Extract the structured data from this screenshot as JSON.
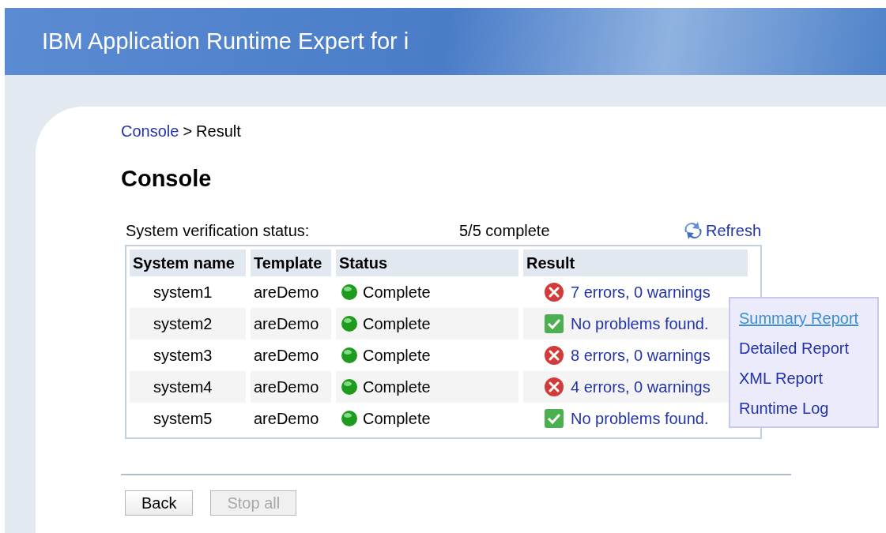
{
  "header": {
    "title": "IBM Application Runtime Expert for i"
  },
  "breadcrumb": {
    "link": "Console",
    "separator": ">",
    "current": "Result"
  },
  "heading": "Console",
  "status_line": {
    "label": "System verification status:",
    "value": "5/5 complete",
    "refresh": "Refresh"
  },
  "table": {
    "columns": [
      "System name",
      "Template",
      "Status",
      "Result"
    ],
    "rows": [
      {
        "system": "system1",
        "template": "areDemo",
        "status": "Complete",
        "result": "7 errors, 0 warnings",
        "kind": "error"
      },
      {
        "system": "system2",
        "template": "areDemo",
        "status": "Complete",
        "result": "No problems found.",
        "kind": "ok"
      },
      {
        "system": "system3",
        "template": "areDemo",
        "status": "Complete",
        "result": "8 errors, 0 warnings",
        "kind": "error"
      },
      {
        "system": "system4",
        "template": "areDemo",
        "status": "Complete",
        "result": "4 errors, 0 warnings",
        "kind": "error"
      },
      {
        "system": "system5",
        "template": "areDemo",
        "status": "Complete",
        "result": "No problems found.",
        "kind": "ok"
      }
    ]
  },
  "popup_menu": {
    "items": [
      {
        "label": "Summary Report",
        "selected": true
      },
      {
        "label": "Detailed Report",
        "selected": false
      },
      {
        "label": "XML Report",
        "selected": false
      },
      {
        "label": "Runtime Log",
        "selected": false
      }
    ]
  },
  "buttons": [
    {
      "label": "Back",
      "disabled": false
    },
    {
      "label": "Stop all",
      "disabled": true
    }
  ]
}
